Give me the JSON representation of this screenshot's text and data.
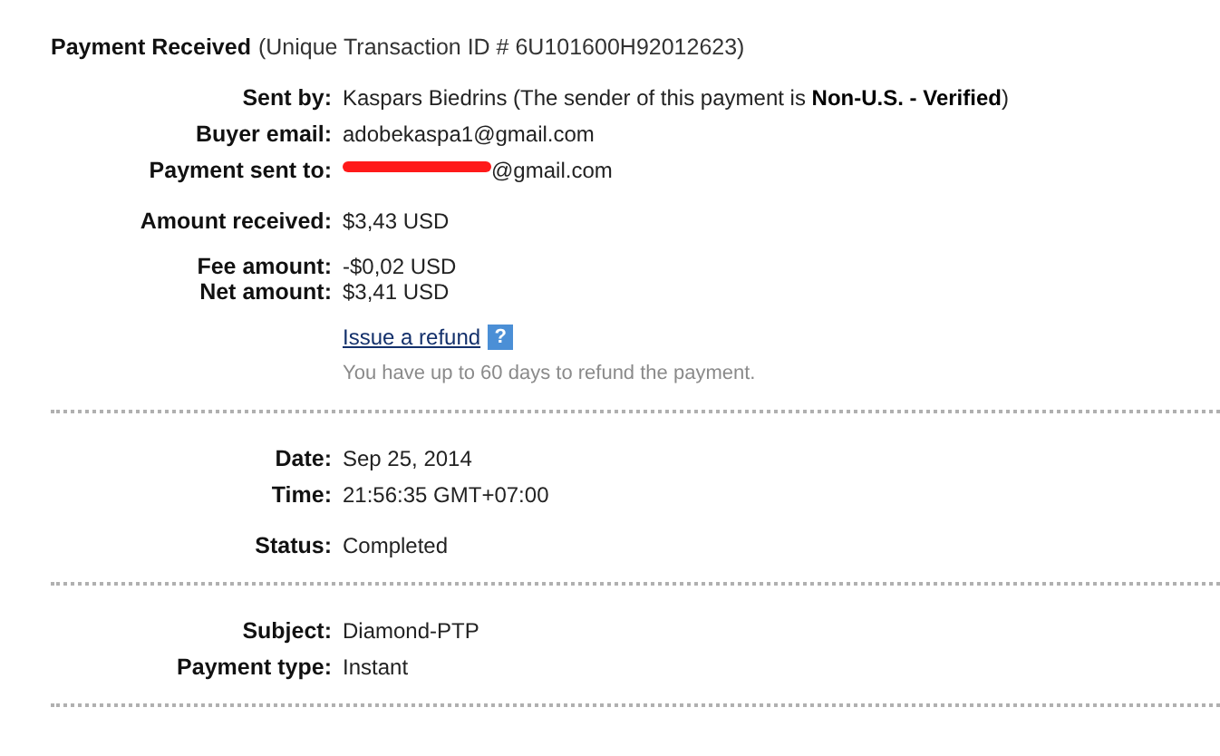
{
  "header": {
    "title": "Payment Received",
    "subtitle": "(Unique Transaction ID # 6U101600H92012623)"
  },
  "sections": [
    {
      "groups": [
        {
          "rows": [
            {
              "kind": "field",
              "label": "Sent by:",
              "value": "Kaspars Biedrins (The sender of this payment is **Non-U.S. - Verified**)"
            },
            {
              "kind": "field",
              "label": "Buyer email:",
              "value": "adobekaspa1@gmail.com"
            },
            {
              "kind": "field",
              "label": "Payment sent to:",
              "value": "@gmail.com",
              "redacted": true
            }
          ]
        },
        {
          "rows": [
            {
              "kind": "field",
              "label": "Amount received:",
              "value": "$3,43 USD"
            }
          ]
        },
        {
          "rows": [
            {
              "kind": "tight",
              "label": "Fee amount:",
              "value": "-$0,02 USD"
            },
            {
              "kind": "tight",
              "label": "Net amount:",
              "value": "$3,41 USD"
            }
          ]
        },
        {
          "rows": [
            {
              "kind": "link",
              "value": "Issue a refund",
              "help": "?"
            },
            {
              "kind": "note",
              "value": "You have up to 60 days to refund the payment."
            }
          ]
        }
      ]
    },
    {
      "groups": [
        {
          "rows": [
            {
              "kind": "field",
              "label": "Date:",
              "value": "Sep 25, 2014"
            },
            {
              "kind": "field",
              "label": "Time:",
              "value": "21:56:35 GMT+07:00"
            }
          ]
        },
        {
          "rows": [
            {
              "kind": "field",
              "label": "Status:",
              "value": "Completed"
            }
          ]
        }
      ]
    },
    {
      "groups": [
        {
          "rows": [
            {
              "kind": "field",
              "label": "Subject:",
              "value": "Diamond-PTP"
            },
            {
              "kind": "field",
              "label": "Payment type:",
              "value": "Instant"
            }
          ]
        }
      ]
    }
  ]
}
